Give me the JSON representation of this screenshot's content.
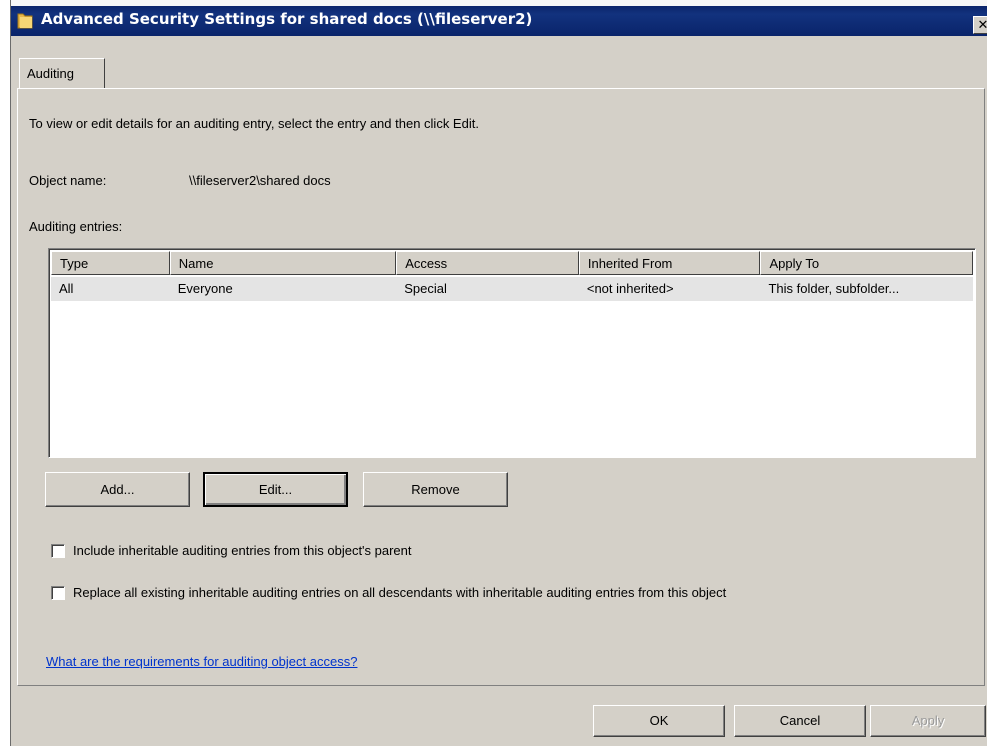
{
  "window": {
    "title": "Advanced Security Settings for shared docs (\\\\fileserver2)",
    "close_glyph": "✕"
  },
  "tab": {
    "label": "Auditing"
  },
  "instructions": "To view or edit details for an auditing entry, select the entry and then click Edit.",
  "object": {
    "label": "Object name:",
    "value": "\\\\fileserver2\\shared docs"
  },
  "entries": {
    "label": "Auditing entries:",
    "columns": [
      "Type",
      "Name",
      "Access",
      "Inherited From",
      "Apply To"
    ],
    "rows": [
      [
        "All",
        "Everyone",
        "Special",
        "<not inherited>",
        "This folder, subfolder..."
      ]
    ]
  },
  "buttons": {
    "add": "Add...",
    "edit": "Edit...",
    "remove": "Remove"
  },
  "options": {
    "include_inheritable": "Include inheritable auditing entries from this object's parent",
    "replace_all": "Replace all existing inheritable auditing entries on all descendants with inheritable auditing entries from this object"
  },
  "help_link": "What are the requirements for auditing object access?",
  "footer": {
    "ok": "OK",
    "cancel": "Cancel",
    "apply": "Apply"
  },
  "icons": {
    "folder": "folder-icon",
    "close": "close-icon"
  },
  "colors": {
    "titlebar": "#0a246a",
    "face": "#d4d0c8",
    "link": "#0033cc",
    "selected_row": "#e4e4e4"
  }
}
